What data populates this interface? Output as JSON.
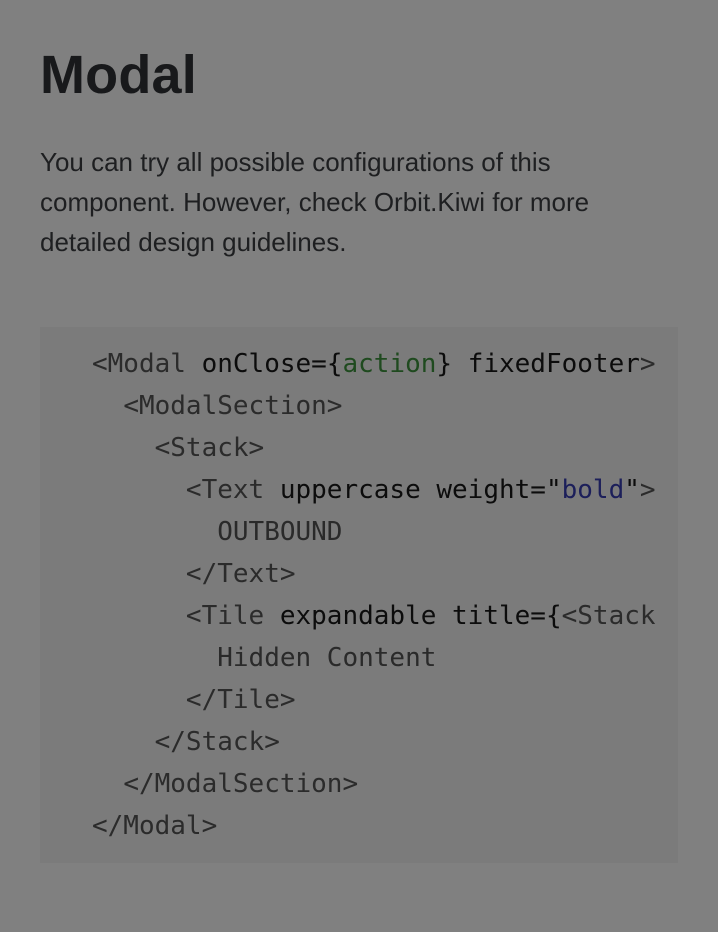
{
  "page": {
    "title": "Modal",
    "description": "You can try all possible configurations of this component. However, check Orbit.Kiwi for more detailed design guidelines."
  },
  "code": {
    "lines": [
      {
        "indent": "",
        "parts": [
          {
            "t": "tag",
            "v": "<Modal "
          },
          {
            "t": "attr",
            "v": "onClose="
          },
          {
            "t": "attr",
            "v": "{"
          },
          {
            "t": "str-green",
            "v": "action"
          },
          {
            "t": "attr",
            "v": "} fixedFooter"
          },
          {
            "t": "tag",
            "v": ">"
          }
        ]
      },
      {
        "indent": "  ",
        "parts": [
          {
            "t": "tag",
            "v": "<ModalSection>"
          }
        ]
      },
      {
        "indent": "    ",
        "parts": [
          {
            "t": "tag",
            "v": "<Stack>"
          }
        ]
      },
      {
        "indent": "      ",
        "parts": [
          {
            "t": "tag",
            "v": "<Text "
          },
          {
            "t": "attr",
            "v": "uppercase weight=\""
          },
          {
            "t": "str-blue",
            "v": "bold"
          },
          {
            "t": "attr",
            "v": "\""
          },
          {
            "t": "tag",
            "v": ">"
          }
        ]
      },
      {
        "indent": "        ",
        "parts": [
          {
            "t": "txt",
            "v": "OUTBOUND"
          }
        ]
      },
      {
        "indent": "      ",
        "parts": [
          {
            "t": "tag",
            "v": "</Text>"
          }
        ]
      },
      {
        "indent": "      ",
        "parts": [
          {
            "t": "tag",
            "v": "<Tile "
          },
          {
            "t": "attr",
            "v": "expandable title={"
          },
          {
            "t": "tag",
            "v": "<Stack"
          }
        ]
      },
      {
        "indent": "        ",
        "parts": [
          {
            "t": "txt",
            "v": "Hidden Content"
          }
        ]
      },
      {
        "indent": "      ",
        "parts": [
          {
            "t": "tag",
            "v": "</Tile>"
          }
        ]
      },
      {
        "indent": "    ",
        "parts": [
          {
            "t": "tag",
            "v": "</Stack>"
          }
        ]
      },
      {
        "indent": "  ",
        "parts": [
          {
            "t": "tag",
            "v": "</ModalSection>"
          }
        ]
      },
      {
        "indent": "",
        "parts": [
          {
            "t": "tag",
            "v": "</Modal>"
          }
        ]
      }
    ]
  }
}
